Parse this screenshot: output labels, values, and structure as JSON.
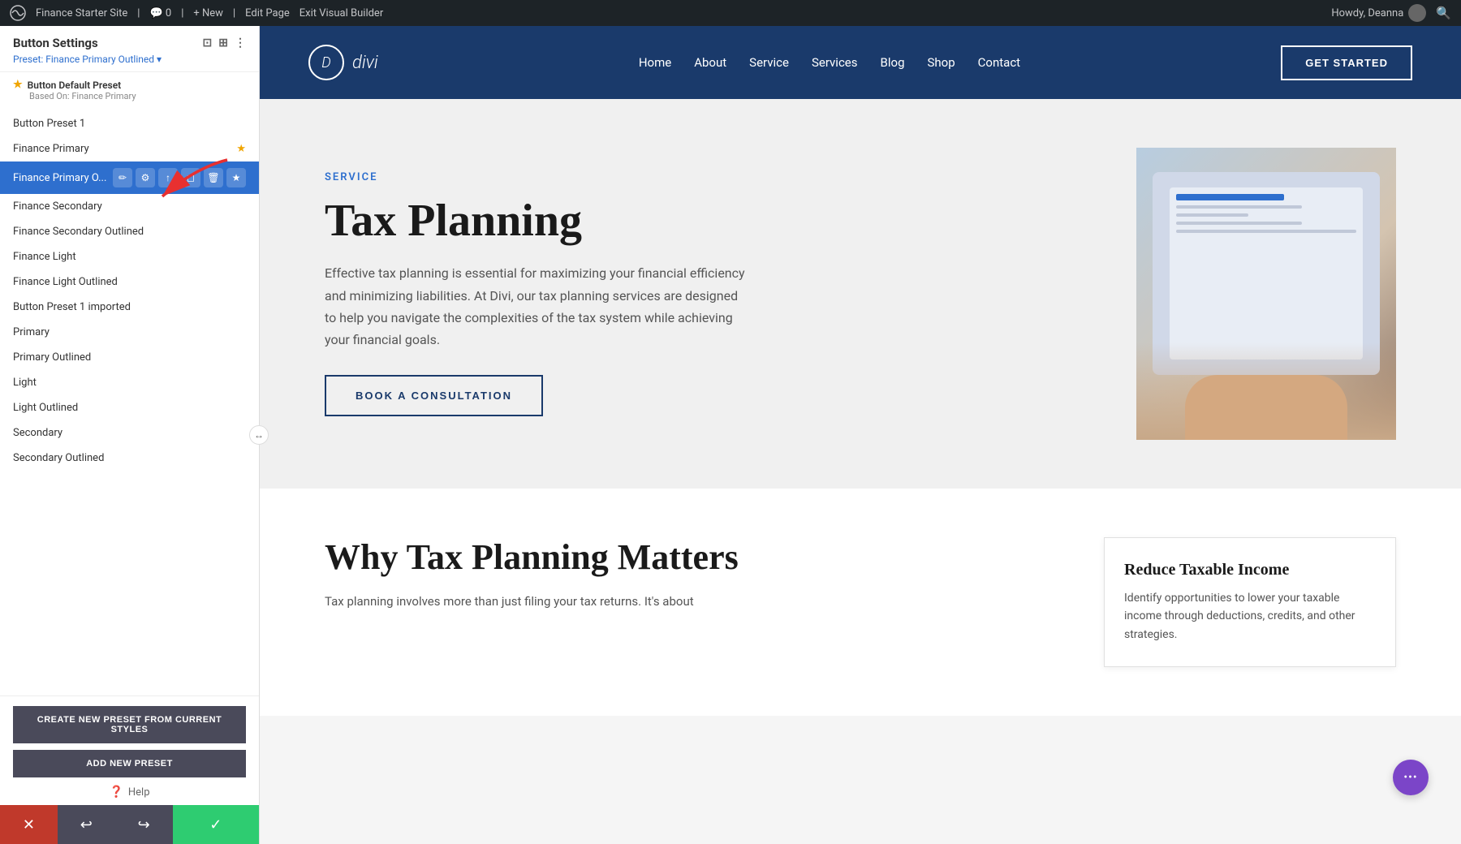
{
  "adminBar": {
    "wpLabel": "WordPress",
    "siteName": "Finance Starter Site",
    "comments": "0",
    "newLabel": "+ New",
    "editLabel": "Edit Page",
    "exitLabel": "Exit Visual Builder",
    "howdy": "Howdy, Deanna",
    "searchIcon": "🔍"
  },
  "panel": {
    "title": "Button Settings",
    "subtitle": "Preset: Finance Primary Outlined ▾",
    "icons": [
      "⊡",
      "⊞",
      "⋮"
    ],
    "sectionHeader": {
      "label": "Button Default Preset",
      "star": "★",
      "basedOn": "Based On: Finance Primary"
    },
    "presets": [
      {
        "id": "button-preset-1",
        "label": "Button Preset 1",
        "star": false,
        "active": false
      },
      {
        "id": "finance-primary",
        "label": "Finance Primary",
        "star": true,
        "active": false
      },
      {
        "id": "finance-primary-outlined",
        "label": "Finance Primary O...",
        "star": true,
        "active": true
      },
      {
        "id": "finance-secondary",
        "label": "Finance Secondary",
        "star": false,
        "active": false
      },
      {
        "id": "finance-secondary-outlined",
        "label": "Finance Secondary Outlined",
        "star": false,
        "active": false
      },
      {
        "id": "finance-light",
        "label": "Finance Light",
        "star": false,
        "active": false
      },
      {
        "id": "finance-light-outlined",
        "label": "Finance Light Outlined",
        "star": false,
        "active": false
      },
      {
        "id": "button-preset-1-imported",
        "label": "Button Preset 1 imported",
        "star": false,
        "active": false
      },
      {
        "id": "primary",
        "label": "Primary",
        "star": false,
        "active": false
      },
      {
        "id": "primary-outlined",
        "label": "Primary Outlined",
        "star": false,
        "active": false
      },
      {
        "id": "light",
        "label": "Light",
        "star": false,
        "active": false
      },
      {
        "id": "light-outlined",
        "label": "Light Outlined",
        "star": false,
        "active": false
      },
      {
        "id": "secondary",
        "label": "Secondary",
        "star": false,
        "active": false
      },
      {
        "id": "secondary-outlined",
        "label": "Secondary Outlined",
        "star": false,
        "active": false
      }
    ],
    "actionIcons": [
      "✏️",
      "⚙",
      "↑",
      "◻",
      "🗑",
      "★"
    ],
    "createPresetBtn": "CREATE NEW PRESET FROM CURRENT STYLES",
    "addPresetBtn": "ADD NEW PRESET",
    "helpLabel": "Help"
  },
  "bottomBar": {
    "cancel": "✕",
    "undo": "↩",
    "redo": "↪",
    "save": "✓"
  },
  "siteHeader": {
    "logoD": "D",
    "logoText": "divi",
    "nav": [
      "Home",
      "About",
      "Service",
      "Services",
      "Blog",
      "Shop",
      "Contact"
    ],
    "ctaLabel": "GET STARTED"
  },
  "heroSection": {
    "category": "SERVICE",
    "title": "Tax Planning",
    "description": "Effective tax planning is essential for maximizing your financial efficiency and minimizing liabilities. At Divi, our tax planning services are designed to help you navigate the complexities of the tax system while achieving your financial goals.",
    "ctaLabel": "BOOK A CONSULTATION"
  },
  "secondSection": {
    "title": "Why Tax Planning Matters",
    "description": "Tax planning involves more than just filing your tax returns. It's about",
    "card": {
      "title": "Reduce Taxable Income",
      "description": "Identify opportunities to lower your taxable income through deductions, credits, and other strategies."
    }
  },
  "floatBtn": "•••"
}
